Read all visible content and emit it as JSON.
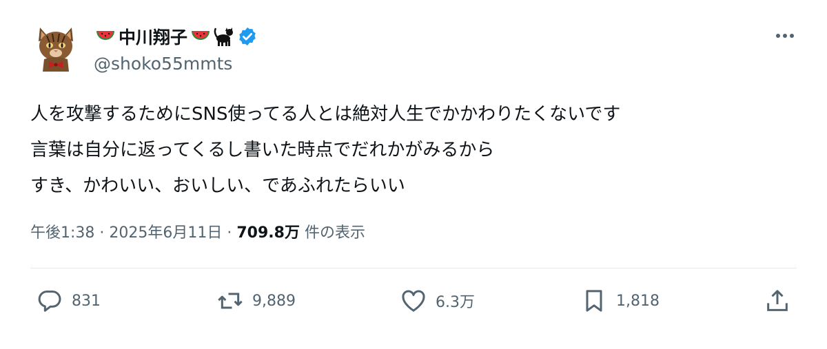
{
  "author": {
    "display_name": "中川翔子",
    "handle": "@shoko55mmts",
    "verified_icon": "verified-badge-icon",
    "name_emojis": [
      "watermelon",
      "watermelon",
      "black-cat"
    ],
    "badge_color": "#1d9bf0"
  },
  "tweet": {
    "lines": [
      "人を攻撃するためにSNS使ってる人とは絶対人生でかかわりたくないです",
      "言葉は自分に返ってくるし書いた時点でだれかがみるから",
      "すき、かわいい、おいしい、であふれたらいい"
    ]
  },
  "meta": {
    "time": "午後1:38",
    "sep1": " · ",
    "date": "2025年6月11日",
    "sep2": " · ",
    "views": "709.8万",
    "views_suffix": " 件の表示"
  },
  "actions": {
    "replies": "831",
    "retweets": "9,889",
    "likes": "6.3万",
    "bookmarks": "1,818"
  },
  "colors": {
    "text": "#0f1419",
    "secondary": "#536471",
    "divider": "#e6e9ec"
  }
}
